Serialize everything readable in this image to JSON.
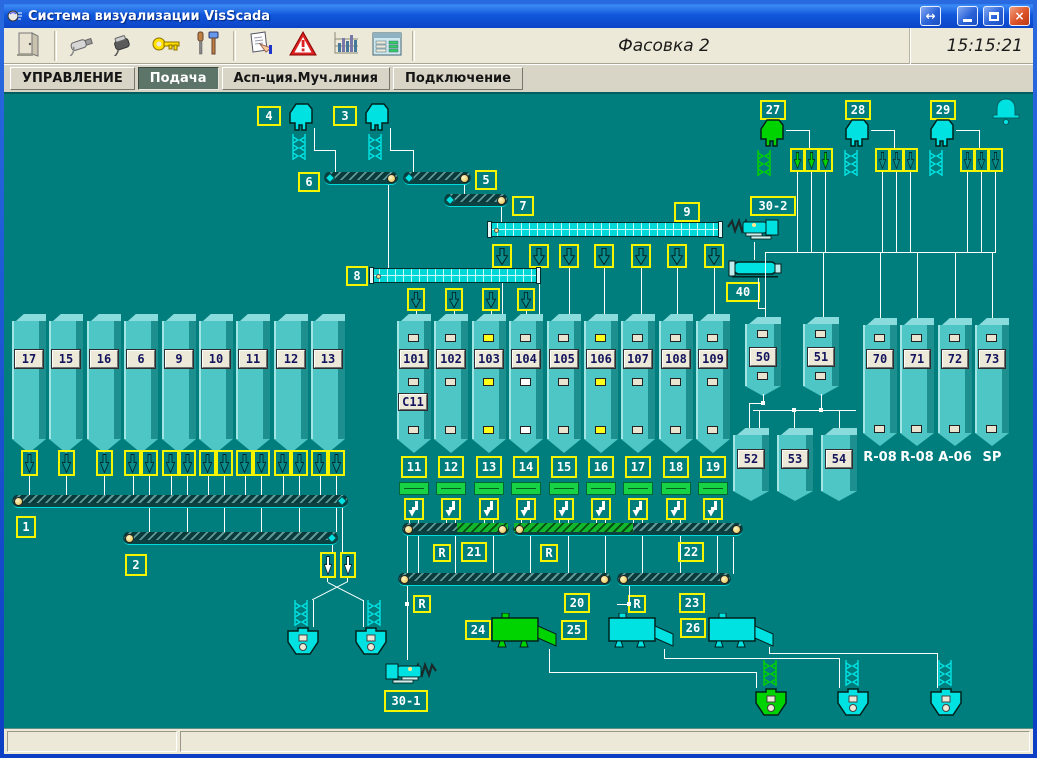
{
  "window": {
    "title": "Система визуализации VisScada",
    "controls": {
      "restore": "↔",
      "minimize": "_",
      "maximize": "□",
      "close": "×"
    }
  },
  "toolbar": {
    "screen_title": "Фасовка 2",
    "clock": "15:15:21",
    "buttons": [
      {
        "id": "exit",
        "icon": "door-icon"
      },
      {
        "id": "connect",
        "icon": "plug-icon"
      },
      {
        "id": "port",
        "icon": "cable-icon"
      },
      {
        "id": "access",
        "icon": "key-icon"
      },
      {
        "id": "setup",
        "icon": "tools-icon"
      },
      {
        "id": "journal",
        "icon": "journal-icon"
      },
      {
        "id": "alarms",
        "icon": "warning-icon"
      },
      {
        "id": "trends",
        "icon": "trend-icon"
      },
      {
        "id": "reports",
        "icon": "report-icon"
      }
    ]
  },
  "tabs": [
    {
      "label": "УПРАВЛЕНИЕ",
      "active": false
    },
    {
      "label": "Подача",
      "active": true
    },
    {
      "label": "Асп-ция.Муч.линия",
      "active": false
    },
    {
      "label": "Подключение",
      "active": false
    }
  ],
  "statusbar": {
    "left": "",
    "right": ""
  },
  "mimic": {
    "palette": {
      "background": "#007e7e",
      "silo_face": "#4fc6c6",
      "silo_shade": "#1d8f8f",
      "silo_top": "#8adcdc",
      "device_cyan": "#00e2e2",
      "active_green": "#00d400",
      "arrow_teal": "#0a8c8c",
      "tag_border": "#f5f500",
      "line": "#ffffff",
      "belt_green": "#12b72e",
      "label_bg": "#ece9d8"
    },
    "top_cyclones": [
      {
        "tag": "4",
        "state": "idle"
      },
      {
        "tag": "3",
        "state": "idle"
      }
    ],
    "head_conveyors": [
      {
        "tag": "6"
      },
      {
        "tag": "5"
      },
      {
        "tag": "7"
      }
    ],
    "screw_conveyors": [
      {
        "tag": "8",
        "outlets": 4
      },
      {
        "tag": "9",
        "outlets": 7
      }
    ],
    "screw_feeders": [
      {
        "tag": "30-2"
      },
      {
        "tag": "30-1"
      }
    ],
    "rotary_blower": {
      "tag": "40"
    },
    "right_cyclones": [
      {
        "tag": "27",
        "state": "active",
        "outlets": 3
      },
      {
        "tag": "28",
        "state": "idle",
        "outlets": 3
      },
      {
        "tag": "29",
        "state": "idle",
        "outlets": 3
      }
    ],
    "alarm_bell": {
      "present": true
    },
    "left_silos": {
      "labels": [
        "17",
        "15",
        "16",
        "6",
        "9",
        "10",
        "11",
        "12",
        "13"
      ],
      "outlets": [
        1,
        1,
        1,
        2,
        2,
        2,
        2,
        2,
        2
      ]
    },
    "collector_conveyors": [
      {
        "tag": "1"
      },
      {
        "tag": "2"
      }
    ],
    "mid_silos": [
      {
        "label": "101",
        "extra_label": "C11",
        "indicators": [
          "beige",
          "beige",
          "beige"
        ]
      },
      {
        "label": "102",
        "indicators": [
          "beige",
          "beige",
          "beige"
        ]
      },
      {
        "label": "103",
        "indicators": [
          "yellow",
          "yellow",
          "yellow"
        ]
      },
      {
        "label": "104",
        "indicators": [
          "beige",
          "white",
          "white"
        ]
      },
      {
        "label": "105",
        "indicators": [
          "beige",
          "beige",
          "beige"
        ]
      },
      {
        "label": "106",
        "indicators": [
          "yellow",
          "yellow",
          "yellow"
        ]
      },
      {
        "label": "107",
        "indicators": [
          "beige",
          "beige",
          "beige"
        ]
      },
      {
        "label": "108",
        "indicators": [
          "beige",
          "beige",
          "beige"
        ]
      },
      {
        "label": "109",
        "indicators": [
          "beige",
          "beige",
          "beige"
        ]
      }
    ],
    "gates": {
      "tags": [
        "11",
        "12",
        "13",
        "14",
        "15",
        "16",
        "17",
        "18",
        "19"
      ]
    },
    "line_conveyors": [
      {
        "tag": "21",
        "reverse": "R"
      },
      {
        "tag": "22",
        "reverse": "R"
      },
      {
        "tag": "20",
        "reverse": "R"
      },
      {
        "tag": "23",
        "reverse": "R"
      }
    ],
    "packers": [
      {
        "tag": "24",
        "state": "active"
      },
      {
        "tag": "25",
        "state": "idle"
      },
      {
        "tag": "26",
        "state": "idle"
      }
    ],
    "outfeed_hoppers": [
      {
        "state": "active"
      },
      {
        "state": "idle"
      },
      {
        "state": "idle"
      }
    ],
    "weigh_hoppers": [
      {
        "state": "idle"
      },
      {
        "state": "idle"
      }
    ],
    "day_bins": [
      {
        "label": "50"
      },
      {
        "label": "51"
      }
    ],
    "mix_bins": [
      {
        "label": "52"
      },
      {
        "label": "53"
      },
      {
        "label": "54"
      }
    ],
    "supply_silos": [
      {
        "label": "70",
        "product": "R-08"
      },
      {
        "label": "71",
        "product": "R-08"
      },
      {
        "label": "72",
        "product": "A-06"
      },
      {
        "label": "73",
        "product": "SP"
      }
    ]
  }
}
